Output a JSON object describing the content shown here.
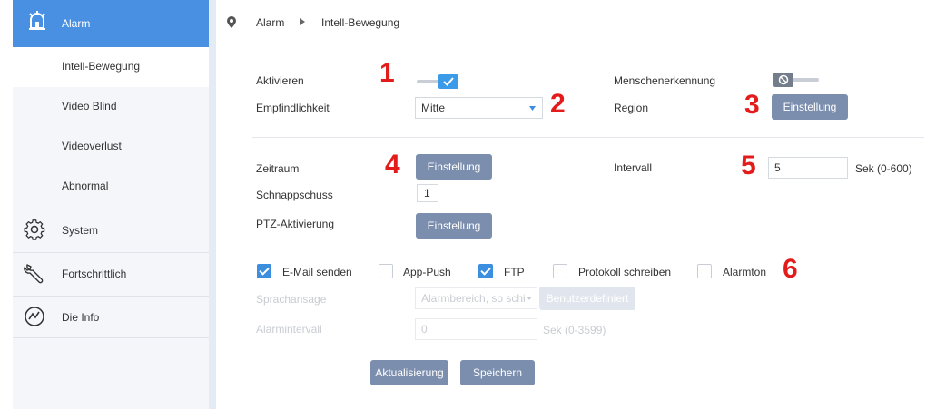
{
  "sidebar": {
    "header": {
      "label": "Alarm",
      "icon": "alarm-bell-icon"
    },
    "sub_items": [
      {
        "label": "Intell-Bewegung",
        "selected": true
      },
      {
        "label": "Video Blind"
      },
      {
        "label": "Videoverlust"
      },
      {
        "label": "Abnormal"
      }
    ],
    "main_items": [
      {
        "label": "System",
        "icon": "gear-icon"
      },
      {
        "label": "Fortschrittlich",
        "icon": "wrench-icon"
      },
      {
        "label": "Die Info",
        "icon": "chart-info-icon"
      }
    ]
  },
  "breadcrumb": {
    "root": "Alarm",
    "current": "Intell-Bewegung"
  },
  "form": {
    "activate_label": "Aktivieren",
    "activate_on": true,
    "human_detect_label": "Menschenerkennung",
    "human_detect_on": false,
    "sensitivity_label": "Empfindlichkeit",
    "sensitivity_value": "Mitte",
    "region_label": "Region",
    "setting_label": "Einstellung",
    "period_label": "Zeitraum",
    "interval_label": "Intervall",
    "interval_value": "5",
    "interval_unit": "Sek (0-600)",
    "snapshot_label": "Schnappschuss",
    "snapshot_value": "1",
    "ptz_label": "PTZ-Aktivierung",
    "checkboxes": [
      {
        "label": "E-Mail senden",
        "checked": true
      },
      {
        "label": "App-Push",
        "checked": false
      },
      {
        "label": "FTP",
        "checked": true
      },
      {
        "label": "Protokoll schreiben",
        "checked": false
      },
      {
        "label": "Alarmton",
        "checked": false
      }
    ],
    "voice_label": "Sprachansage",
    "voice_value": "Alarmbereich, so schi",
    "custom_label": "Benutzerdefiniert",
    "alarm_interval_label": "Alarmintervall",
    "alarm_interval_value": "0",
    "alarm_interval_unit": "Sek (0-3599)",
    "refresh_label": "Aktualisierung",
    "save_label": "Speichern"
  },
  "annotations": [
    "1",
    "2",
    "3",
    "4",
    "5",
    "6"
  ],
  "colors": {
    "accent": "#4a90e2",
    "button": "#7b8eae",
    "annotation": "#e41b1b"
  }
}
